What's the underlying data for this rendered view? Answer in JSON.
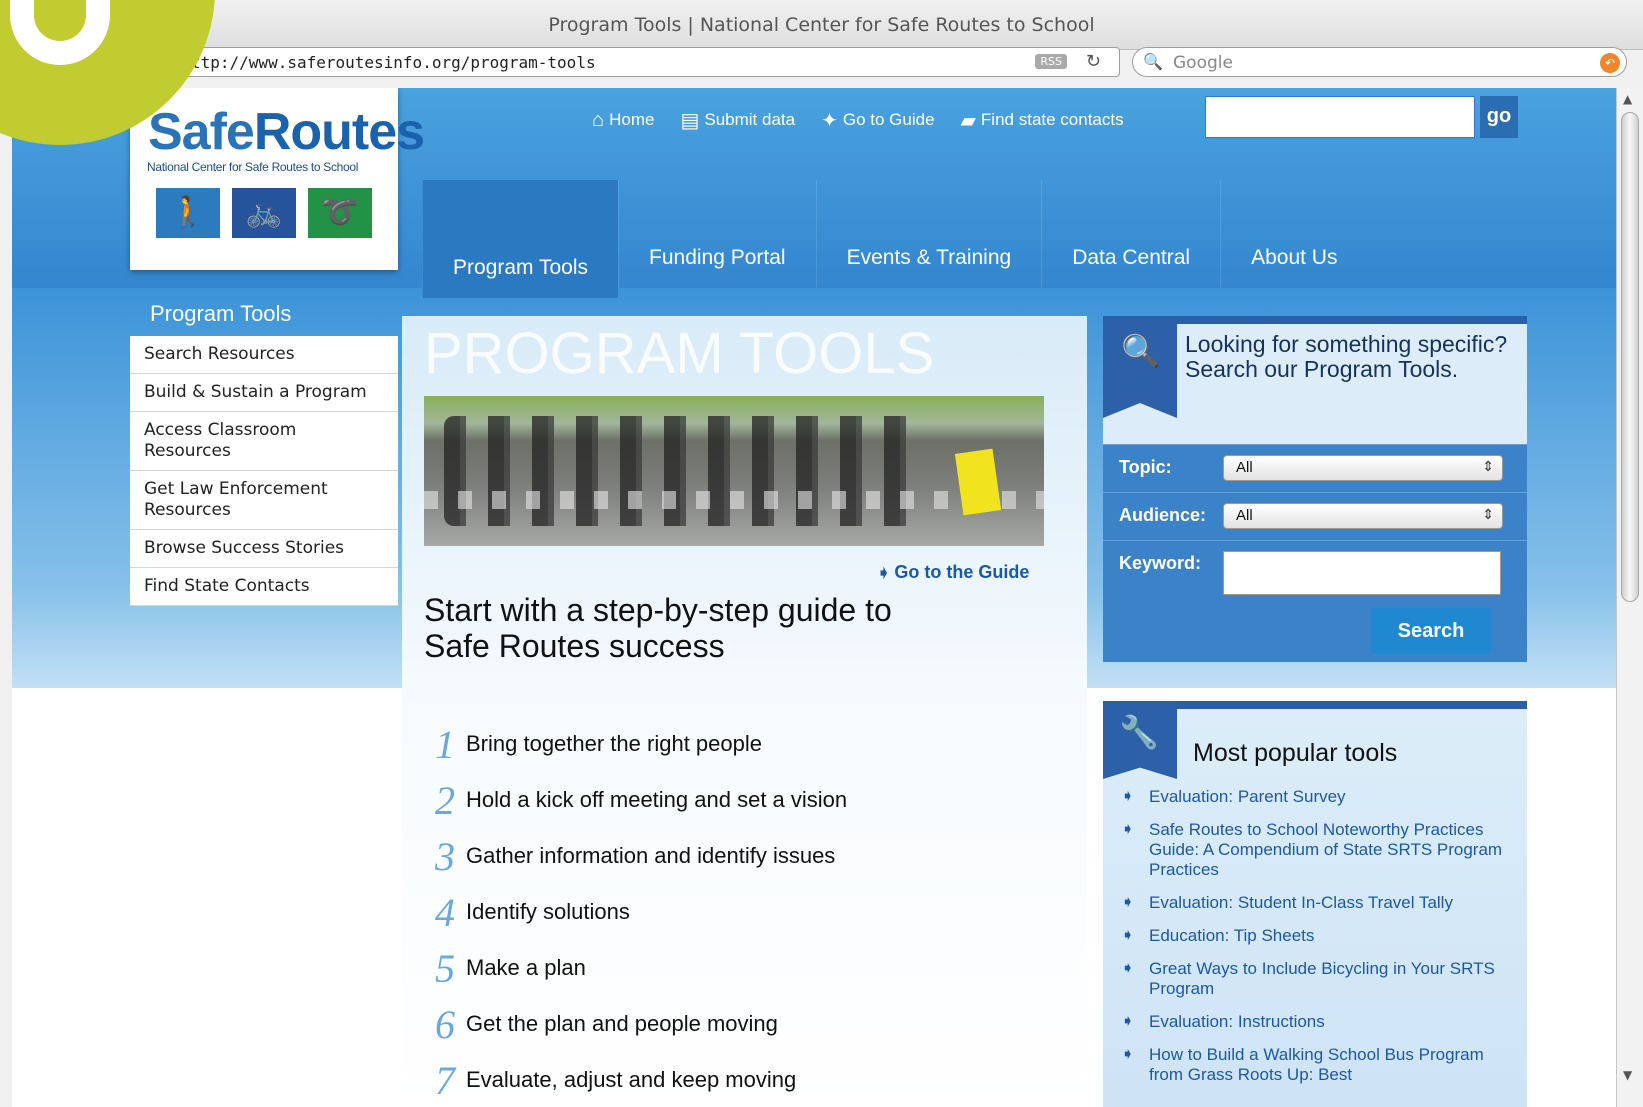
{
  "browser": {
    "window_title": "Program Tools | National Center for Safe Routes to School",
    "url": "ttp://www.saferoutesinfo.org/program-tools",
    "rss_label": "RSS",
    "search_placeholder": "Google"
  },
  "logo": {
    "word_safe": "Safe",
    "word_routes": "Routes",
    "tagline": "National Center for Safe Routes to School"
  },
  "util_nav": [
    {
      "label": "Home",
      "icon": "home-icon"
    },
    {
      "label": "Submit data",
      "icon": "document-icon"
    },
    {
      "label": "Go to Guide",
      "icon": "compass-icon"
    },
    {
      "label": "Find state contacts",
      "icon": "us-map-icon"
    }
  ],
  "top_search": {
    "go_label": "go"
  },
  "main_nav": [
    {
      "label": "Program Tools",
      "active": true
    },
    {
      "label": "Funding Portal"
    },
    {
      "label": "Events & Training"
    },
    {
      "label": "Data Central"
    },
    {
      "label": "About Us"
    }
  ],
  "sidebar": {
    "heading": "Program Tools",
    "items": [
      "Search Resources",
      "Build & Sustain a Program",
      "Access Classroom Resources",
      "Get Law Enforcement Resources",
      "Browse Success Stories",
      "Find State Contacts"
    ]
  },
  "main": {
    "page_title": "PROGRAM TOOLS",
    "guide_link": "Go to the Guide",
    "subheading": "Start with a step-by-step guide to Safe Routes success",
    "steps": [
      {
        "num": "1",
        "text": "Bring together the right people"
      },
      {
        "num": "2",
        "text": "Hold a kick off meeting and set a vision"
      },
      {
        "num": "3",
        "text": "Gather information and identify issues"
      },
      {
        "num": "4",
        "text": "Identify solutions"
      },
      {
        "num": "5",
        "text": "Make a plan"
      },
      {
        "num": "6",
        "text": "Get the plan and people moving"
      },
      {
        "num": "7",
        "text": "Evaluate, adjust and keep moving"
      }
    ]
  },
  "search_panel": {
    "prompt": "Looking for something specific? Search our Program Tools.",
    "topic_label": "Topic:",
    "topic_value": "All",
    "audience_label": "Audience:",
    "audience_value": "All",
    "keyword_label": "Keyword:",
    "search_button": "Search"
  },
  "popular_tools": {
    "heading": "Most popular tools",
    "items": [
      "Evaluation: Parent Survey",
      "Safe Routes to School Noteworthy Practices Guide: A Compendium of State SRTS Program Practices",
      "Evaluation: Student In-Class Travel Tally",
      "Education: Tip Sheets",
      "Great Ways to Include Bicycling in Your SRTS Program",
      "Evaluation: Instructions",
      "How to Build a Walking School Bus Program from Grass Roots Up: Best"
    ]
  },
  "colors": {
    "brand_blue": "#2b73b8",
    "nav_blue": "#3386cf",
    "badge_green": "#c0cc2f",
    "link_blue": "#1d59a2"
  }
}
